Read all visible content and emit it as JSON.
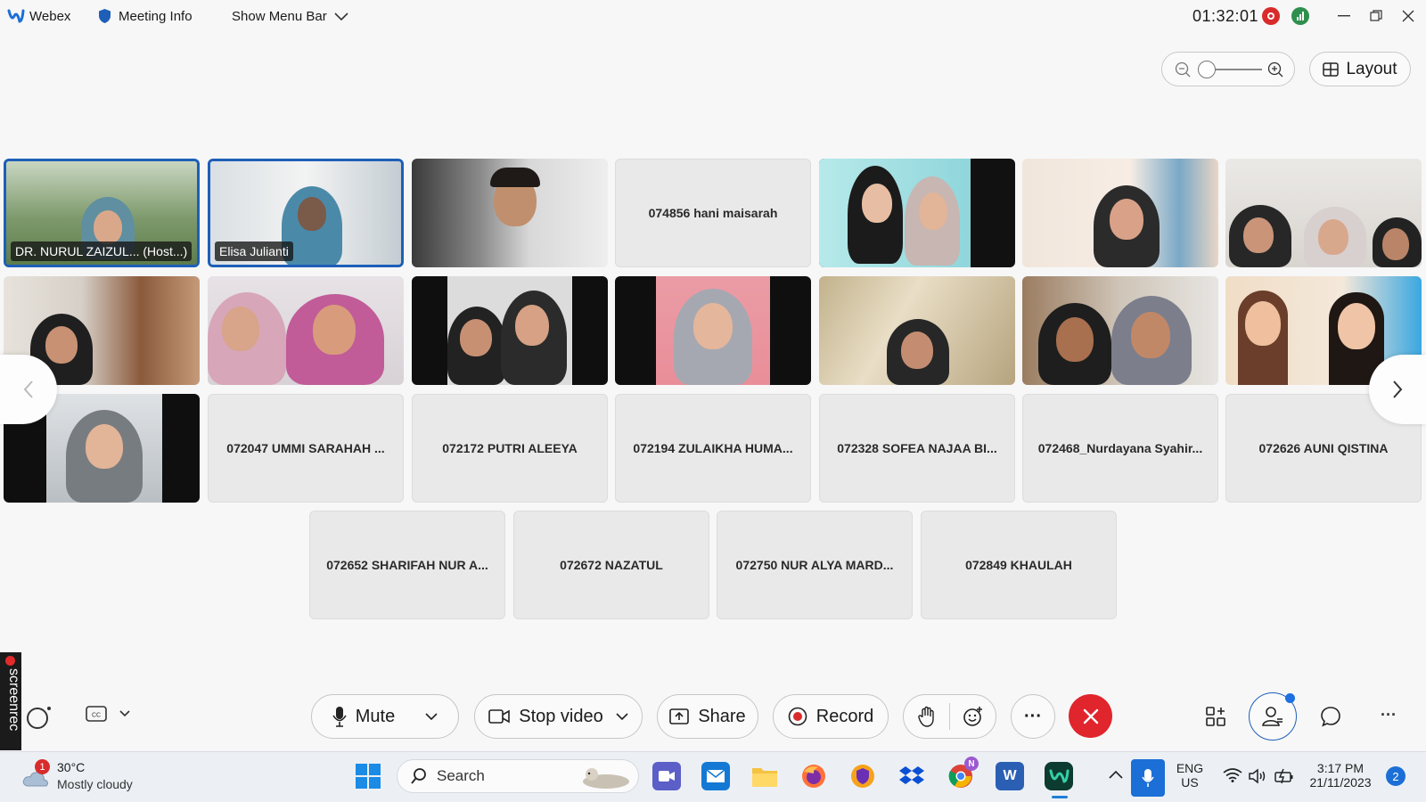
{
  "titlebar": {
    "app_name": "Webex",
    "meeting_info": "Meeting Info",
    "show_menu_bar": "Show Menu Bar",
    "timer": "01:32:01"
  },
  "layout_button": "Layout",
  "tiles_video": [
    {
      "name": "DR. NURUL ZAIZUL... (Host...)",
      "active": true
    },
    {
      "name": "Elisa Julianti",
      "active": true
    }
  ],
  "tiles_names": {
    "r1c4": "074856 hani maisarah",
    "r3c2": "072047 UMMI SARAHAH ...",
    "r3c3": "072172 PUTRI ALEEYA",
    "r3c4": "072194 ZULAIKHA HUMA...",
    "r3c5": "072328 SOFEA NAJAA BI...",
    "r3c6": "072468_Nurdayana Syahir...",
    "r3c7": "072626 AUNI QISTINA",
    "r4c1": "072652 SHARIFAH NUR A...",
    "r4c2": "072672 NAZATUL",
    "r4c3": "072750 NUR ALYA MARD...",
    "r4c4": "072849 KHAULAH"
  },
  "controls": {
    "mute": "Mute",
    "stop_video": "Stop video",
    "share": "Share",
    "record": "Record",
    "more": "···"
  },
  "screenrec_label": "screenrec",
  "taskbar": {
    "weather_temp": "30°C",
    "weather_desc": "Mostly cloudy",
    "weather_badge": "1",
    "search_placeholder": "Search",
    "lang_top": "ENG",
    "lang_bottom": "US",
    "time": "3:17 PM",
    "date": "21/11/2023",
    "notification_count": "2",
    "chrome_badge": "N",
    "word_letter": "W"
  },
  "colors": {
    "accent_blue": "#1e5fb8",
    "end_red": "#e0252d",
    "record_red": "#d92b2b"
  }
}
